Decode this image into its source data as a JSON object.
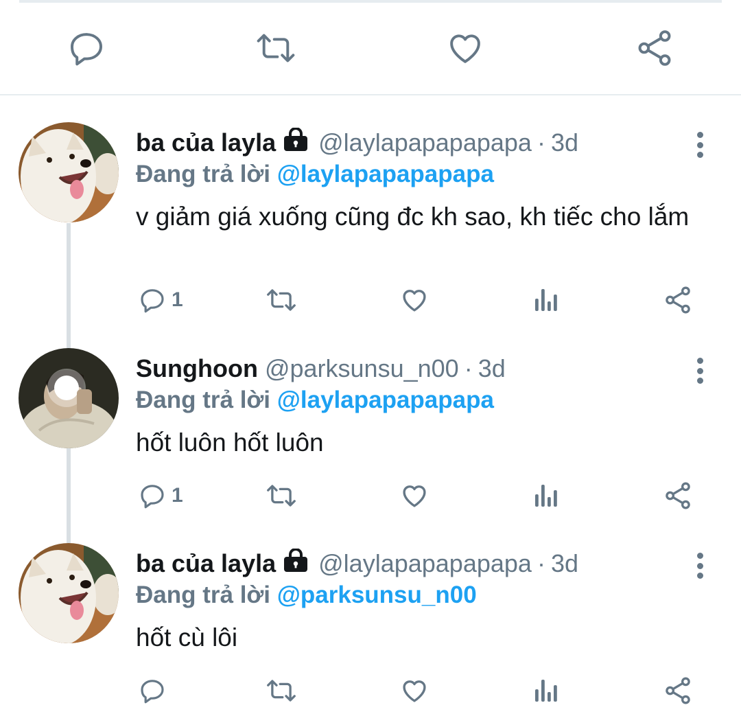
{
  "colors": {
    "icon_gray": "#657786",
    "mention_blue": "#1da1f2",
    "divider": "#e6ecf0",
    "thread_line": "#d9dfe3"
  },
  "top_actions": [
    {
      "name": "reply-icon"
    },
    {
      "name": "retweet-icon"
    },
    {
      "name": "like-icon"
    },
    {
      "name": "share-icon"
    }
  ],
  "tweets": [
    {
      "display_name": "ba của layla",
      "protected": true,
      "handle": "@laylapapapapapa",
      "separator": "·",
      "time": "3d",
      "reply_prefix": "Đang trả lời",
      "reply_to": "@laylapapapapapa",
      "text": "v giảm giá xuống cũng đc kh sao, kh tiếc cho lắm",
      "reply_count": "1",
      "avatar": "dog-avatar"
    },
    {
      "display_name": "Sunghoon",
      "protected": false,
      "handle": "@parksunsu_n00",
      "separator": "·",
      "time": "3d",
      "reply_prefix": "Đang trả lời",
      "reply_to": "@laylapapapapapa",
      "text": "hốt luôn hốt luôn",
      "reply_count": "1",
      "avatar": "person-avatar"
    },
    {
      "display_name": "ba của layla",
      "protected": true,
      "handle": "@laylapapapapapa",
      "separator": "·",
      "time": "3d",
      "reply_prefix": "Đang trả lời",
      "reply_to": "@parksunsu_n00",
      "text": "hốt cù lôi",
      "reply_count": "",
      "avatar": "dog-avatar"
    }
  ]
}
